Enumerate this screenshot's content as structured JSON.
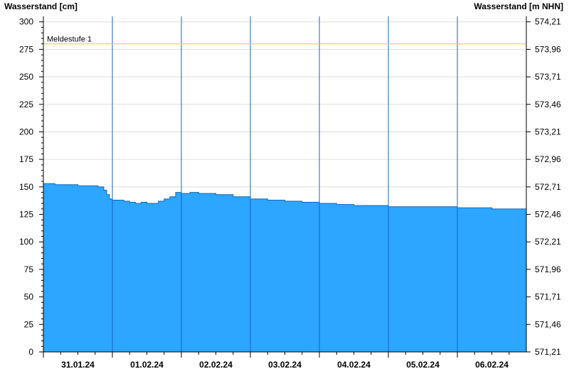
{
  "colors": {
    "fill": "#2ca6ff",
    "outline": "#1565c0",
    "grid": "#dddddd",
    "reference_line": "#e8c96a",
    "axis": "#000000"
  },
  "chart_data": {
    "type": "area",
    "ylabel_left": "Wasserstand [cm]",
    "ylabel_right": "Wasserstand [m NHN]",
    "ylim": [
      0,
      305
    ],
    "yticks_left": [
      "0",
      "25",
      "50",
      "75",
      "100",
      "125",
      "150",
      "175",
      "200",
      "225",
      "250",
      "275",
      "300"
    ],
    "yticks_right": [
      "571,21",
      "571,46",
      "571,71",
      "571,96",
      "572,21",
      "572,46",
      "572,71",
      "572,96",
      "573,21",
      "573,46",
      "573,71",
      "573,96",
      "574,21"
    ],
    "grid": true,
    "xlim": [
      "31.01.24 00:00",
      "06.02.24 23:59"
    ],
    "xticks": [
      "31.01.24",
      "01.02.24",
      "02.02.24",
      "03.02.24",
      "04.02.24",
      "05.02.24",
      "06.02.24"
    ],
    "reference_line": {
      "label": "Meldestufe 1",
      "value": 280
    },
    "series": [
      {
        "x": [
          "31.01.24 00:00",
          "31.01.24 04:00",
          "31.01.24 08:00",
          "31.01.24 12:00",
          "31.01.24 16:00",
          "31.01.24 19:00",
          "31.01.24 21:00",
          "31.01.24 22:00",
          "31.01.24 23:00",
          "01.02.24 00:00",
          "01.02.24 04:00",
          "01.02.24 06:00",
          "01.02.24 08:00",
          "01.02.24 10:00",
          "01.02.24 12:00",
          "01.02.24 14:00",
          "01.02.24 16:00",
          "01.02.24 18:00",
          "01.02.24 20:00",
          "01.02.24 22:00",
          "02.02.24 00:00",
          "02.02.24 03:00",
          "02.02.24 06:00",
          "02.02.24 12:00",
          "02.02.24 18:00",
          "03.02.24 00:00",
          "03.02.24 06:00",
          "03.02.24 12:00",
          "03.02.24 18:00",
          "04.02.24 00:00",
          "04.02.24 06:00",
          "04.02.24 12:00",
          "05.02.24 00:00",
          "05.02.24 12:00",
          "06.02.24 00:00",
          "06.02.24 12:00",
          "06.02.24 23:59"
        ],
        "values": [
          153,
          152,
          152,
          151,
          151,
          150,
          147,
          143,
          139,
          138,
          137,
          136,
          135,
          136,
          135,
          135,
          137,
          139,
          141,
          145,
          144,
          145,
          144,
          143,
          141,
          139,
          138,
          137,
          136,
          135,
          134,
          133,
          132,
          132,
          131,
          130,
          129
        ]
      }
    ]
  }
}
